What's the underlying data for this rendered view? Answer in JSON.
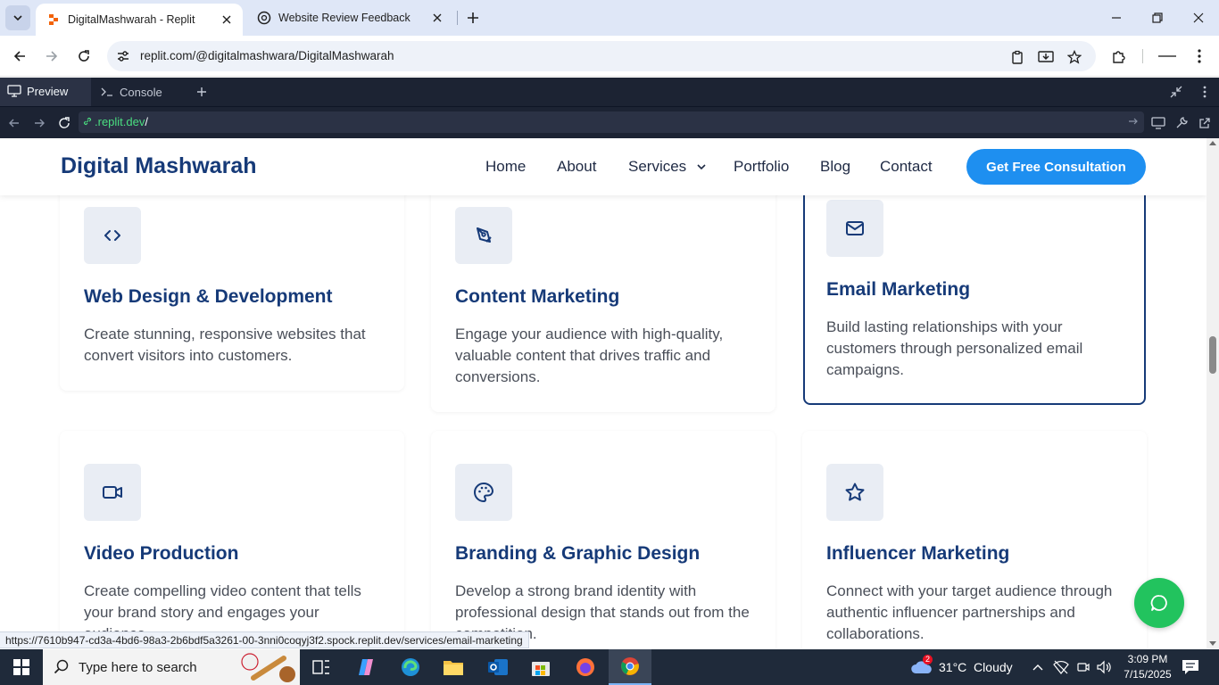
{
  "browser": {
    "tabs": [
      {
        "title": "DigitalMashwarah - Replit",
        "active": true
      },
      {
        "title": "Website Review Feedback",
        "active": false
      }
    ],
    "url": "replit.com/@digitalmashwara/DigitalMashwarah"
  },
  "replit": {
    "tabs": [
      {
        "label": "Preview"
      },
      {
        "label": "Console"
      }
    ],
    "preview_url_host": ".replit.dev",
    "preview_url_path": "/"
  },
  "site": {
    "logo": "Digital Mashwarah",
    "nav": {
      "home": "Home",
      "about": "About",
      "services": "Services",
      "portfolio": "Portfolio",
      "blog": "Blog",
      "contact": "Contact"
    },
    "cta": "Get Free Consultation",
    "services": [
      {
        "title": "Web Design & Development",
        "desc": "Create stunning, responsive websites that convert visitors into customers.",
        "icon": "code-icon"
      },
      {
        "title": "Content Marketing",
        "desc": "Engage your audience with high-quality, valuable content that drives traffic and conversions.",
        "icon": "pen-tool-icon"
      },
      {
        "title": "Email Marketing",
        "desc": "Build lasting relationships with your customers through personalized email campaigns.",
        "icon": "mail-icon"
      },
      {
        "title": "Video Production",
        "desc": "Create compelling video content that tells your brand story and engages your audience.",
        "icon": "video-icon"
      },
      {
        "title": "Branding & Graphic Design",
        "desc": "Develop a strong brand identity with professional design that stands out from the competition.",
        "icon": "palette-icon"
      },
      {
        "title": "Influencer Marketing",
        "desc": "Connect with your target audience through authentic influencer partnerships and collaborations.",
        "icon": "star-icon"
      }
    ]
  },
  "status_bar_url": "https://7610b947-cd3a-4bd6-98a3-2b6bdf5a3261-00-3nni0coqyj3f2.spock.replit.dev/services/email-marketing",
  "taskbar": {
    "search_placeholder": "Type here to search",
    "weather": "31°C  Cloudy",
    "weather_badge": "2",
    "time": "3:09 PM",
    "date": "7/15/2025"
  },
  "colors": {
    "brand_navy": "#163a78",
    "cta_blue": "#1e8ff0",
    "chat_green": "#22c35e",
    "replit_dark": "#1c2333"
  }
}
